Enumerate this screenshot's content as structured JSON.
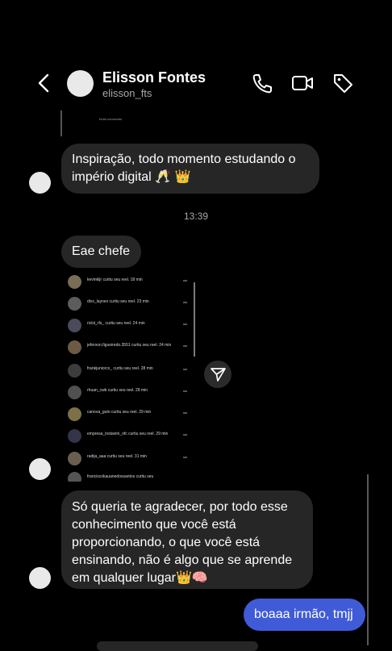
{
  "header": {
    "name": "Elisson Fontes",
    "username": "elisson_fts",
    "icons": {
      "back": "chevron-left-icon",
      "call": "phone-icon",
      "video": "video-camera-icon",
      "tag": "tag-icon"
    }
  },
  "shared_caption": "fonte:conduzido",
  "messages": {
    "m1": "Inspiração, todo momento estudando o império digital 🥂 👑",
    "timestamp": "13:39",
    "m2": "Eae chefe",
    "m3": "Só queria te agradecer, por todo esse conhecimento que você está proporcionando, o que você está ensinando, não é algo que se aprende em qualquer lugar👑🧠",
    "m4": "boaaa irmão, tmjj"
  },
  "notifications": [
    {
      "user": "kevinkljr",
      "text": "kevinkljr curtiu seu reel. 18 min"
    },
    {
      "user": "dixx_laynex",
      "text": "dixx_laynex curtiu seu reel. 23 min"
    },
    {
      "user": "rickii_rfs",
      "text": "rickii_rfs_ curtiu seu reel. 24 min"
    },
    {
      "user": "jeferson.figueiredo.3551",
      "text": "jeferson.figueiredo.3551 curtiu seu reel. 24 min"
    },
    {
      "user": "frankjuniorcx",
      "text": "frankjuniorcx_ curtiu seu reel. 28 min"
    },
    {
      "user": "rhuan_cwb",
      "text": "rhuan_cwb curtiu seu reel. 28 min"
    },
    {
      "user": "canova_guto",
      "text": "canova_guto curtiu seu reel. 29 min"
    },
    {
      "user": "empresa_instavini_ofc",
      "text": "empresa_instavini_ofc curtiu seu reel. 29 min"
    },
    {
      "user": "radija_aaa",
      "text": "radija_aaa curtiu seu reel. 31 min"
    },
    {
      "user": "franciscokauanedossantos",
      "text": "franciscokauanedossantos curtiu seu"
    }
  ]
}
